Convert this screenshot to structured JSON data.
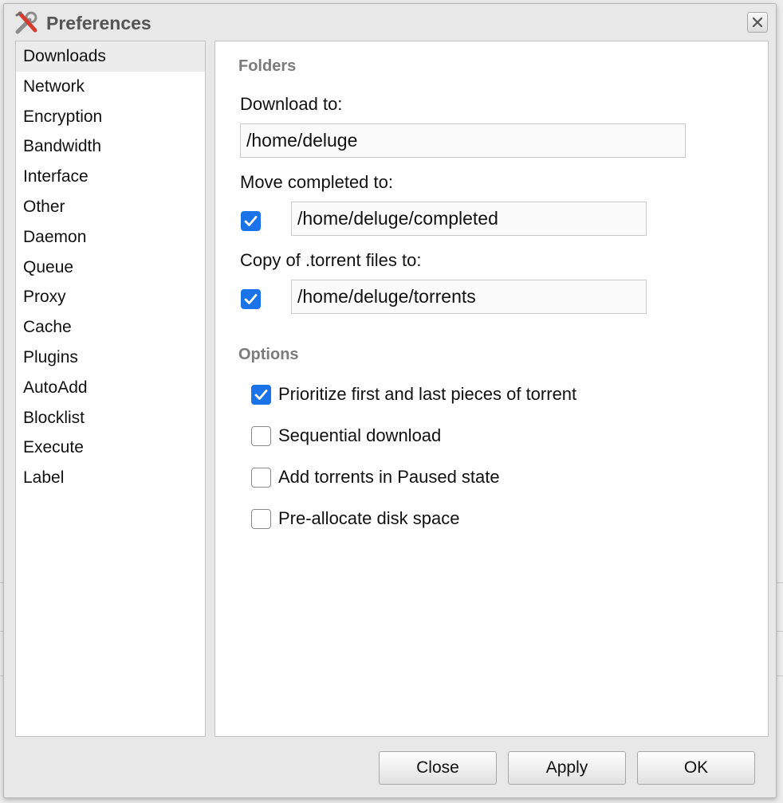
{
  "window": {
    "title": "Preferences"
  },
  "nav": {
    "active_index": 0,
    "items": [
      "Downloads",
      "Network",
      "Encryption",
      "Bandwidth",
      "Interface",
      "Other",
      "Daemon",
      "Queue",
      "Proxy",
      "Cache",
      "Plugins",
      "AutoAdd",
      "Blocklist",
      "Execute",
      "Label"
    ]
  },
  "folders": {
    "heading": "Folders",
    "download_to_label": "Download to:",
    "download_to_value": "/home/deluge",
    "move_completed_label": "Move completed to:",
    "move_completed_checked": true,
    "move_completed_value": "/home/deluge/completed",
    "copy_torrent_label": "Copy of .torrent files to:",
    "copy_torrent_checked": true,
    "copy_torrent_value": "/home/deluge/torrents"
  },
  "options": {
    "heading": "Options",
    "items": [
      {
        "label": "Prioritize first and last pieces of torrent",
        "checked": true
      },
      {
        "label": "Sequential download",
        "checked": false
      },
      {
        "label": "Add torrents in Paused state",
        "checked": false
      },
      {
        "label": "Pre-allocate disk space",
        "checked": false
      }
    ]
  },
  "buttons": {
    "close": "Close",
    "apply": "Apply",
    "ok": "OK"
  },
  "colors": {
    "checkbox_checked": "#1a73e8",
    "section_heading": "#7b7b7b"
  }
}
